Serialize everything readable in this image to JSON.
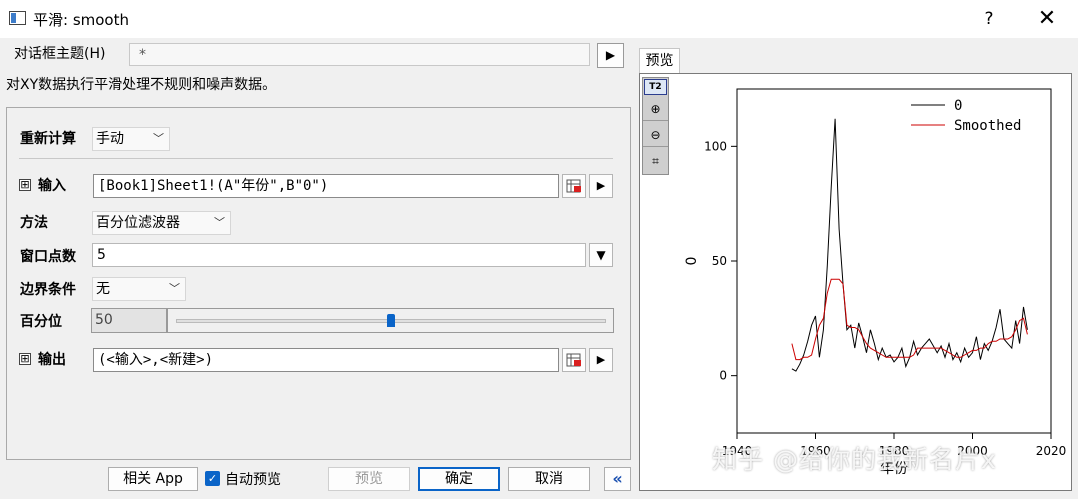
{
  "window": {
    "title": "平滑: smooth",
    "help": "?",
    "close": "✕"
  },
  "theme": {
    "label": "对话框主题(H)",
    "value": "*",
    "arrow": "▶"
  },
  "description": "对XY数据执行平滑处理不规则和噪声数据。",
  "form": {
    "recalc": {
      "label": "重新计算",
      "value": "手动"
    },
    "input": {
      "expander": "⊞",
      "label": "输入",
      "value": "[Book1]Sheet1!(A\"年份\",B\"0\")"
    },
    "method": {
      "label": "方法",
      "value": "百分位滤波器"
    },
    "window_points": {
      "label": "窗口点数",
      "value": "5"
    },
    "boundary": {
      "label": "边界条件",
      "value": "无"
    },
    "percentile": {
      "label": "百分位",
      "value": "50",
      "slider_fraction": 0.5
    },
    "output": {
      "expander": "⊞",
      "label": "输出",
      "value": "(<输入>,<新建>)"
    }
  },
  "buttons": {
    "app": "相关 App",
    "auto_preview": "自动预览",
    "auto_preview_checked": true,
    "preview": "预览",
    "ok": "确定",
    "cancel": "取消",
    "collapse": "«"
  },
  "preview": {
    "tab": "预览",
    "toolbar": {
      "t2": "T2",
      "zoom_in": "⊕",
      "zoom_out": "⊖",
      "fit": "⌗"
    }
  },
  "watermark": "知乎 @给你的我新名片x",
  "colors": {
    "raw_series": "#000000",
    "smoothed_series": "#cc0000",
    "accent": "#0a64c8"
  },
  "chart_data": {
    "type": "line",
    "xlabel": "年份",
    "ylabel": "0",
    "xlim": [
      1940,
      2020
    ],
    "ylim": [
      -25,
      125
    ],
    "xticks": [
      "1940",
      "1960",
      "1980",
      "2000",
      "2020"
    ],
    "yticks": [
      "0",
      "50",
      "100"
    ],
    "legend_position": "top-right",
    "series": [
      {
        "name": "0",
        "x": [
          1954,
          1955,
          1956,
          1957,
          1958,
          1959,
          1960,
          1961,
          1962,
          1963,
          1964,
          1965,
          1966,
          1967,
          1968,
          1969,
          1970,
          1971,
          1972,
          1973,
          1974,
          1975,
          1976,
          1977,
          1978,
          1979,
          1980,
          1981,
          1982,
          1983,
          1984,
          1985,
          1986,
          1987,
          1988,
          1989,
          1990,
          1991,
          1992,
          1993,
          1994,
          1995,
          1996,
          1997,
          1998,
          1999,
          2000,
          2001,
          2002,
          2003,
          2004,
          2005,
          2006,
          2007,
          2008,
          2009,
          2010,
          2011,
          2012,
          2013,
          2014
        ],
        "values": [
          3,
          2,
          5,
          9,
          15,
          22,
          26,
          8,
          20,
          48,
          82,
          112,
          64,
          40,
          20,
          22,
          12,
          23,
          17,
          10,
          20,
          14,
          7,
          12,
          8,
          9,
          6,
          8,
          12,
          4,
          8,
          15,
          9,
          12,
          14,
          16,
          13,
          10,
          13,
          8,
          14,
          7,
          10,
          6,
          12,
          8,
          10,
          17,
          7,
          14,
          11,
          15,
          21,
          29,
          16,
          14,
          12,
          24,
          14,
          30,
          20
        ]
      },
      {
        "name": "Smoothed",
        "x": [
          1954,
          1955,
          1956,
          1957,
          1958,
          1959,
          1960,
          1961,
          1962,
          1963,
          1964,
          1965,
          1966,
          1967,
          1968,
          1969,
          1970,
          1971,
          1972,
          1973,
          1974,
          1975,
          1976,
          1977,
          1978,
          1979,
          1980,
          1981,
          1982,
          1983,
          1984,
          1985,
          1986,
          1987,
          1988,
          1989,
          1990,
          1991,
          1992,
          1993,
          1994,
          1995,
          1996,
          1997,
          1998,
          1999,
          2000,
          2001,
          2002,
          2003,
          2004,
          2005,
          2006,
          2007,
          2008,
          2009,
          2010,
          2011,
          2012,
          2013,
          2014
        ],
        "values": [
          14,
          7,
          7,
          8,
          8,
          9,
          16,
          22,
          25,
          36,
          42,
          42,
          42,
          40,
          22,
          21,
          21,
          20,
          17,
          14,
          12,
          11,
          10,
          9,
          8,
          8,
          8,
          8,
          8,
          8,
          8,
          9,
          12,
          12,
          12,
          12,
          12,
          12,
          12,
          11,
          10,
          9,
          8,
          8,
          9,
          10,
          11,
          11,
          12,
          12,
          14,
          15,
          15,
          16,
          16,
          16,
          17,
          20,
          24,
          25,
          18
        ]
      }
    ]
  }
}
